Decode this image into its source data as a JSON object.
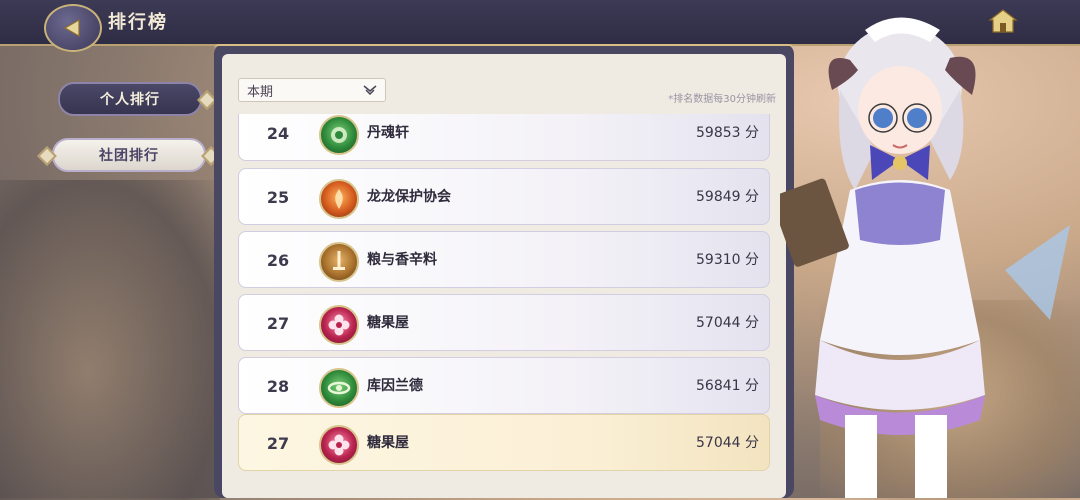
{
  "header": {
    "title": "排行榜"
  },
  "tabs": [
    {
      "label": "个人排行",
      "active": false
    },
    {
      "label": "社团排行",
      "active": true
    }
  ],
  "period": {
    "selected": "本期"
  },
  "refresh_note": "*排名数据每30分钟刷新",
  "score_unit": "分",
  "rows": [
    {
      "rank": "24",
      "name": "丹魂轩",
      "score": "59853 分",
      "emblem": "green-lion-emblem"
    },
    {
      "rank": "25",
      "name": "龙龙保护协会",
      "score": "59849 分",
      "emblem": "orange-flame-emblem"
    },
    {
      "rank": "26",
      "name": "粮与香辛料",
      "score": "59310 分",
      "emblem": "brown-sword-emblem"
    },
    {
      "rank": "27",
      "name": "糖果屋",
      "score": "57044 分",
      "emblem": "pink-flower-emblem"
    },
    {
      "rank": "28",
      "name": "库因兰德",
      "score": "56841 分",
      "emblem": "green-ring-emblem"
    }
  ],
  "my_row": {
    "rank": "27",
    "name": "糖果屋",
    "score": "57044 分",
    "emblem": "pink-flower-emblem"
  },
  "colors": {
    "panel_frame": "#4a4763",
    "panel_bg": "#efeae2",
    "highlight_row": "#fbf0d6",
    "gold_trim": "#d8bd84"
  }
}
